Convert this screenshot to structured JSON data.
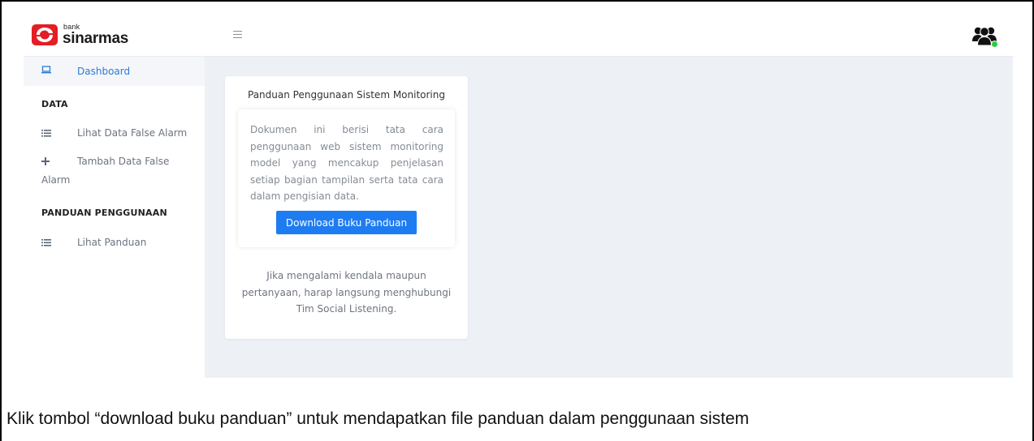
{
  "brand": {
    "small": "bank",
    "name": "sinarmas",
    "accent_color": "#e31e24"
  },
  "header": {
    "menu_icon": "hamburger-icon",
    "user_icon": "users-icon",
    "status_color": "#2ecc40"
  },
  "sidebar": {
    "active_color": "#2d7ad6",
    "items": [
      {
        "icon": "laptop-icon",
        "label": "Dashboard",
        "active": true
      },
      {
        "heading": "DATA"
      },
      {
        "icon": "list-icon",
        "label": "Lihat Data False Alarm"
      },
      {
        "icon": "plus-icon",
        "label_line1": "Tambah Data False",
        "label_line2": "Alarm"
      },
      {
        "heading": "PANDUAN PENGGUNAAN"
      },
      {
        "icon": "list-icon",
        "label": "Lihat Panduan"
      }
    ]
  },
  "card": {
    "title": "Panduan Penggunaan Sistem Monitoring",
    "description": "Dokumen ini berisi tata cara penggunaan web sistem monitoring model yang mencakup penjelasan setiap bagian tampilan serta tata cara dalam pengisian data.",
    "button_label": "Download Buku Panduan",
    "button_color": "#1e7cf2",
    "note_line1": "Jika mengalami kendala maupun",
    "note_line2": "pertanyaan, harap langsung menghubungi",
    "note_line3": "Tim Social Listening."
  },
  "caption": "Klik tombol “download buku panduan” untuk mendapatkan file panduan dalam penggunaan sistem"
}
